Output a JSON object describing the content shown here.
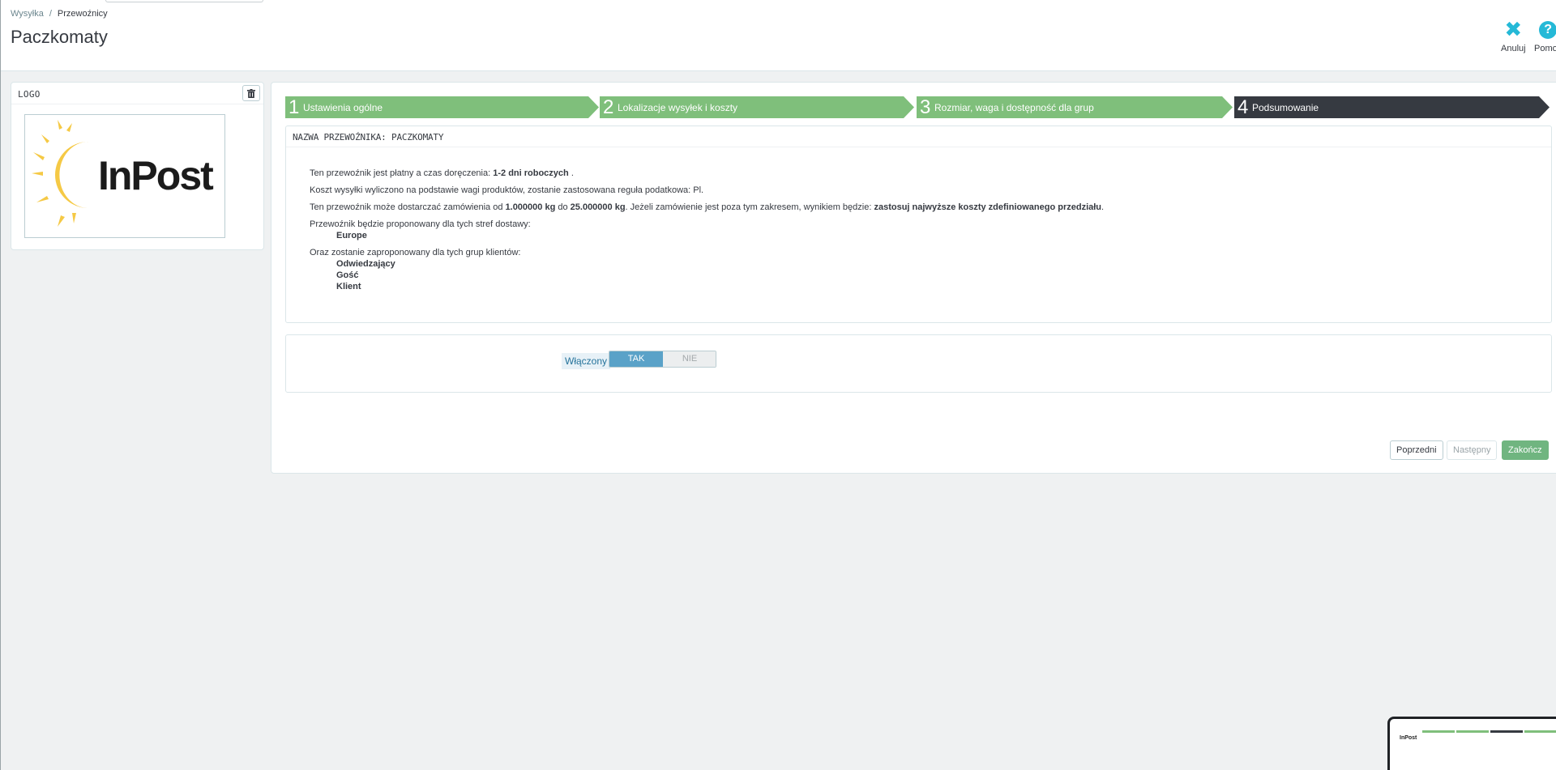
{
  "header": {
    "breadcrumb": [
      "Wysyłka",
      "Przewoźnicy"
    ],
    "breadcrumb_sep": "/",
    "title": "Paczkomaty",
    "toolbar": {
      "cancel_label": "Anuluj",
      "help_label": "Pomoc",
      "cancel_icon": "close-icon",
      "help_icon": "question-circle-icon"
    }
  },
  "logo_panel": {
    "title": "LOGO",
    "delete_icon": "trash-icon",
    "logo_text": "InPost"
  },
  "wizard": {
    "steps": [
      {
        "num": "1",
        "label": "Ustawienia ogólne"
      },
      {
        "num": "2",
        "label": "Lokalizacje wysyłek i koszty"
      },
      {
        "num": "3",
        "label": "Rozmiar, waga i dostępność dla grup"
      },
      {
        "num": "4",
        "label": "Podsumowanie"
      }
    ],
    "active_step": 4
  },
  "summary": {
    "heading": "NAZWA PRZEWOŹNIKA: PACZKOMATY",
    "line1_pre": "Ten przewoźnik jest płatny a czas doręczenia: ",
    "line1_bold": "1-2 dni roboczych",
    "line1_post": " .",
    "line2": "Koszt wysyłki wyliczono na podstawie wagi produktów, zostanie zastosowana reguła podatkowa: Pl.",
    "line3_a": "Ten przewoźnik może dostarczać zamówienia od ",
    "line3_b": "1.000000 kg",
    "line3_c": " do ",
    "line3_d": "25.000000 kg",
    "line3_e": ". Jeżeli zamówienie jest poza tym zakresem, wynikiem będzie: ",
    "line3_f": "zastosuj najwyższe koszty zdefiniowanego przedziału",
    "line3_g": ".",
    "zones_intro": "Przewoźnik będzie proponowany dla tych stref dostawy:",
    "zones": [
      "Europe"
    ],
    "groups_intro": "Oraz zostanie zaproponowany dla tych grup klientów:",
    "groups": [
      "Odwiedzający",
      "Gość",
      "Klient"
    ]
  },
  "status": {
    "label": "Włączony",
    "yes": "TAK",
    "no": "NIE",
    "value": "TAK"
  },
  "buttons": {
    "prev": "Poprzedni",
    "next": "Następny",
    "finish": "Zakończ"
  },
  "colors": {
    "step_done": "#7fbf7b",
    "step_active": "#363a41",
    "accent": "#25b9d7",
    "toggle_on": "#5aa2c8",
    "finish": "#70b580"
  }
}
